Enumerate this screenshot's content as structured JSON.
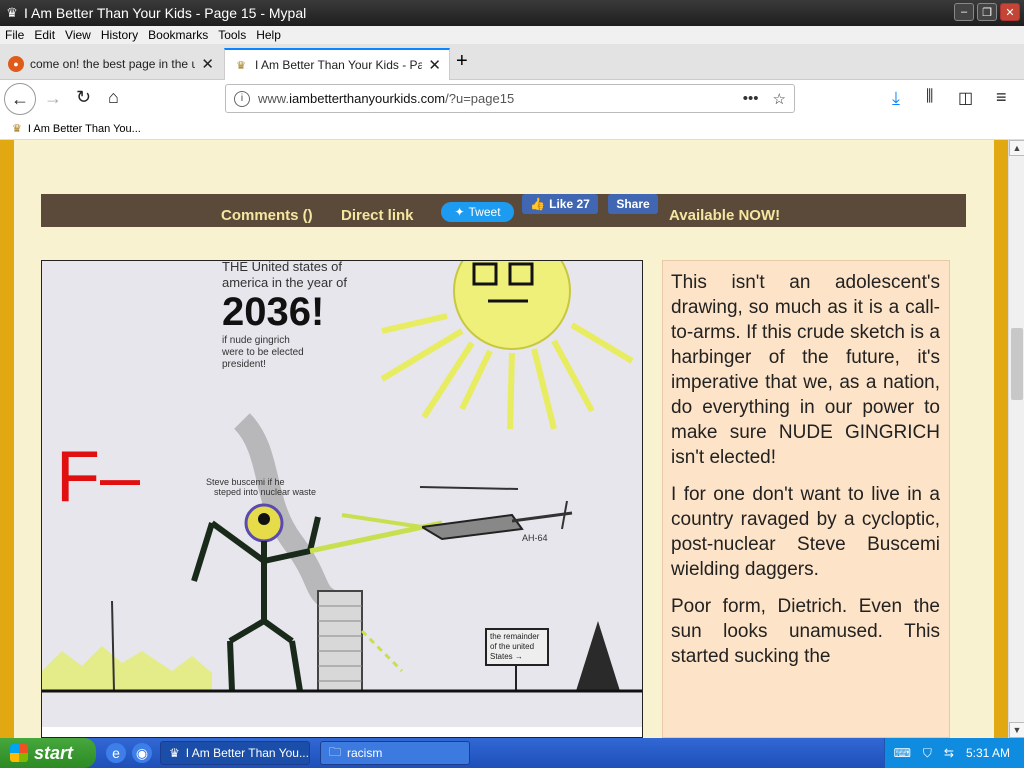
{
  "window": {
    "title": "I Am Better Than Your Kids - Page 15 - Mypal",
    "min": "–",
    "max": "❐",
    "close": "✕"
  },
  "menu": [
    "File",
    "Edit",
    "View",
    "History",
    "Bookmarks",
    "Tools",
    "Help"
  ],
  "tabs": [
    {
      "label": "come on! the best page in the uni",
      "close": "✕"
    },
    {
      "label": "I Am Better Than Your Kids - Page",
      "close": "✕"
    }
  ],
  "nav": {
    "url_prefix": "www.",
    "url_domain": "iambetterthanyourkids.com",
    "url_path": "/?u=page15",
    "more": "•••"
  },
  "bookmarks": [
    {
      "label": "I Am Better Than You..."
    }
  ],
  "share": {
    "comments": "Comments ()",
    "direct_link": "Direct link",
    "tweet": "Tweet",
    "fb_like": "Like 27",
    "fb_share": "Share",
    "available": "Available NOW!"
  },
  "comic": {
    "header_line1": "THE United states of",
    "header_line2": "america in the year of",
    "year": "2036!",
    "sub1": "if nude gingrich",
    "sub2": "were to be elected",
    "sub3": "president!",
    "grade": "F–",
    "steve1": "Steve buscemi if he",
    "steve2": "steped into nuclear waste",
    "heli": "AH-64",
    "sign1": "the remainder",
    "sign2": "of the united",
    "sign3": "States →"
  },
  "commentary": [
    "This isn't an adolescent's drawing, so much as it is a call-to-arms. If this crude sketch is a harbinger of the future, it's imperative that we, as a nation, do everything in our power to make sure NUDE GINGRICH isn't elected!",
    "I for one don't want to live in a country ravaged by a cycloptic, post-nuclear Steve Buscemi wielding daggers.",
    "Poor form, Dietrich. Even the sun looks unamused. This started sucking the"
  ],
  "taskbar": {
    "start": "start",
    "tasks": [
      {
        "label": "I Am Better Than You..."
      },
      {
        "label": "racism"
      }
    ],
    "time": "5:31 AM"
  }
}
